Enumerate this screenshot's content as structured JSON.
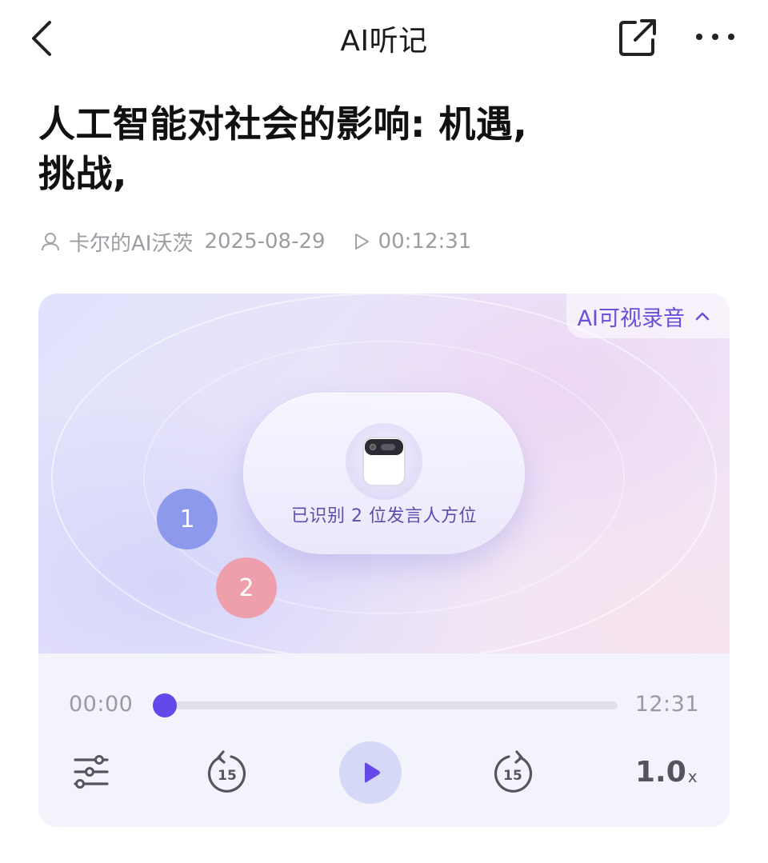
{
  "nav": {
    "title": "AI听记",
    "back_icon": "chevron-left-icon",
    "share_icon": "external-share-icon",
    "more_icon": "more-dots-icon"
  },
  "article": {
    "title_line1": "人工智能对社会的影响: 机遇,",
    "title_line2": "挑战,",
    "author": "卡尔的AI沃茨",
    "date": "2025-08-29",
    "duration": "00:12:31"
  },
  "visual": {
    "mode_tag": "AI可视录音",
    "caption": "已识别 2 位发言人方位",
    "speakers": [
      {
        "label": "1",
        "color": "#8d99ea"
      },
      {
        "label": "2",
        "color": "#ee9fab"
      }
    ]
  },
  "player": {
    "current_time": "00:00",
    "total_time": "12:31",
    "progress": 0,
    "rewind_seconds": "15",
    "forward_seconds": "15",
    "speed_value": "1.0",
    "speed_unit": "x",
    "accent": "#6448ea"
  }
}
